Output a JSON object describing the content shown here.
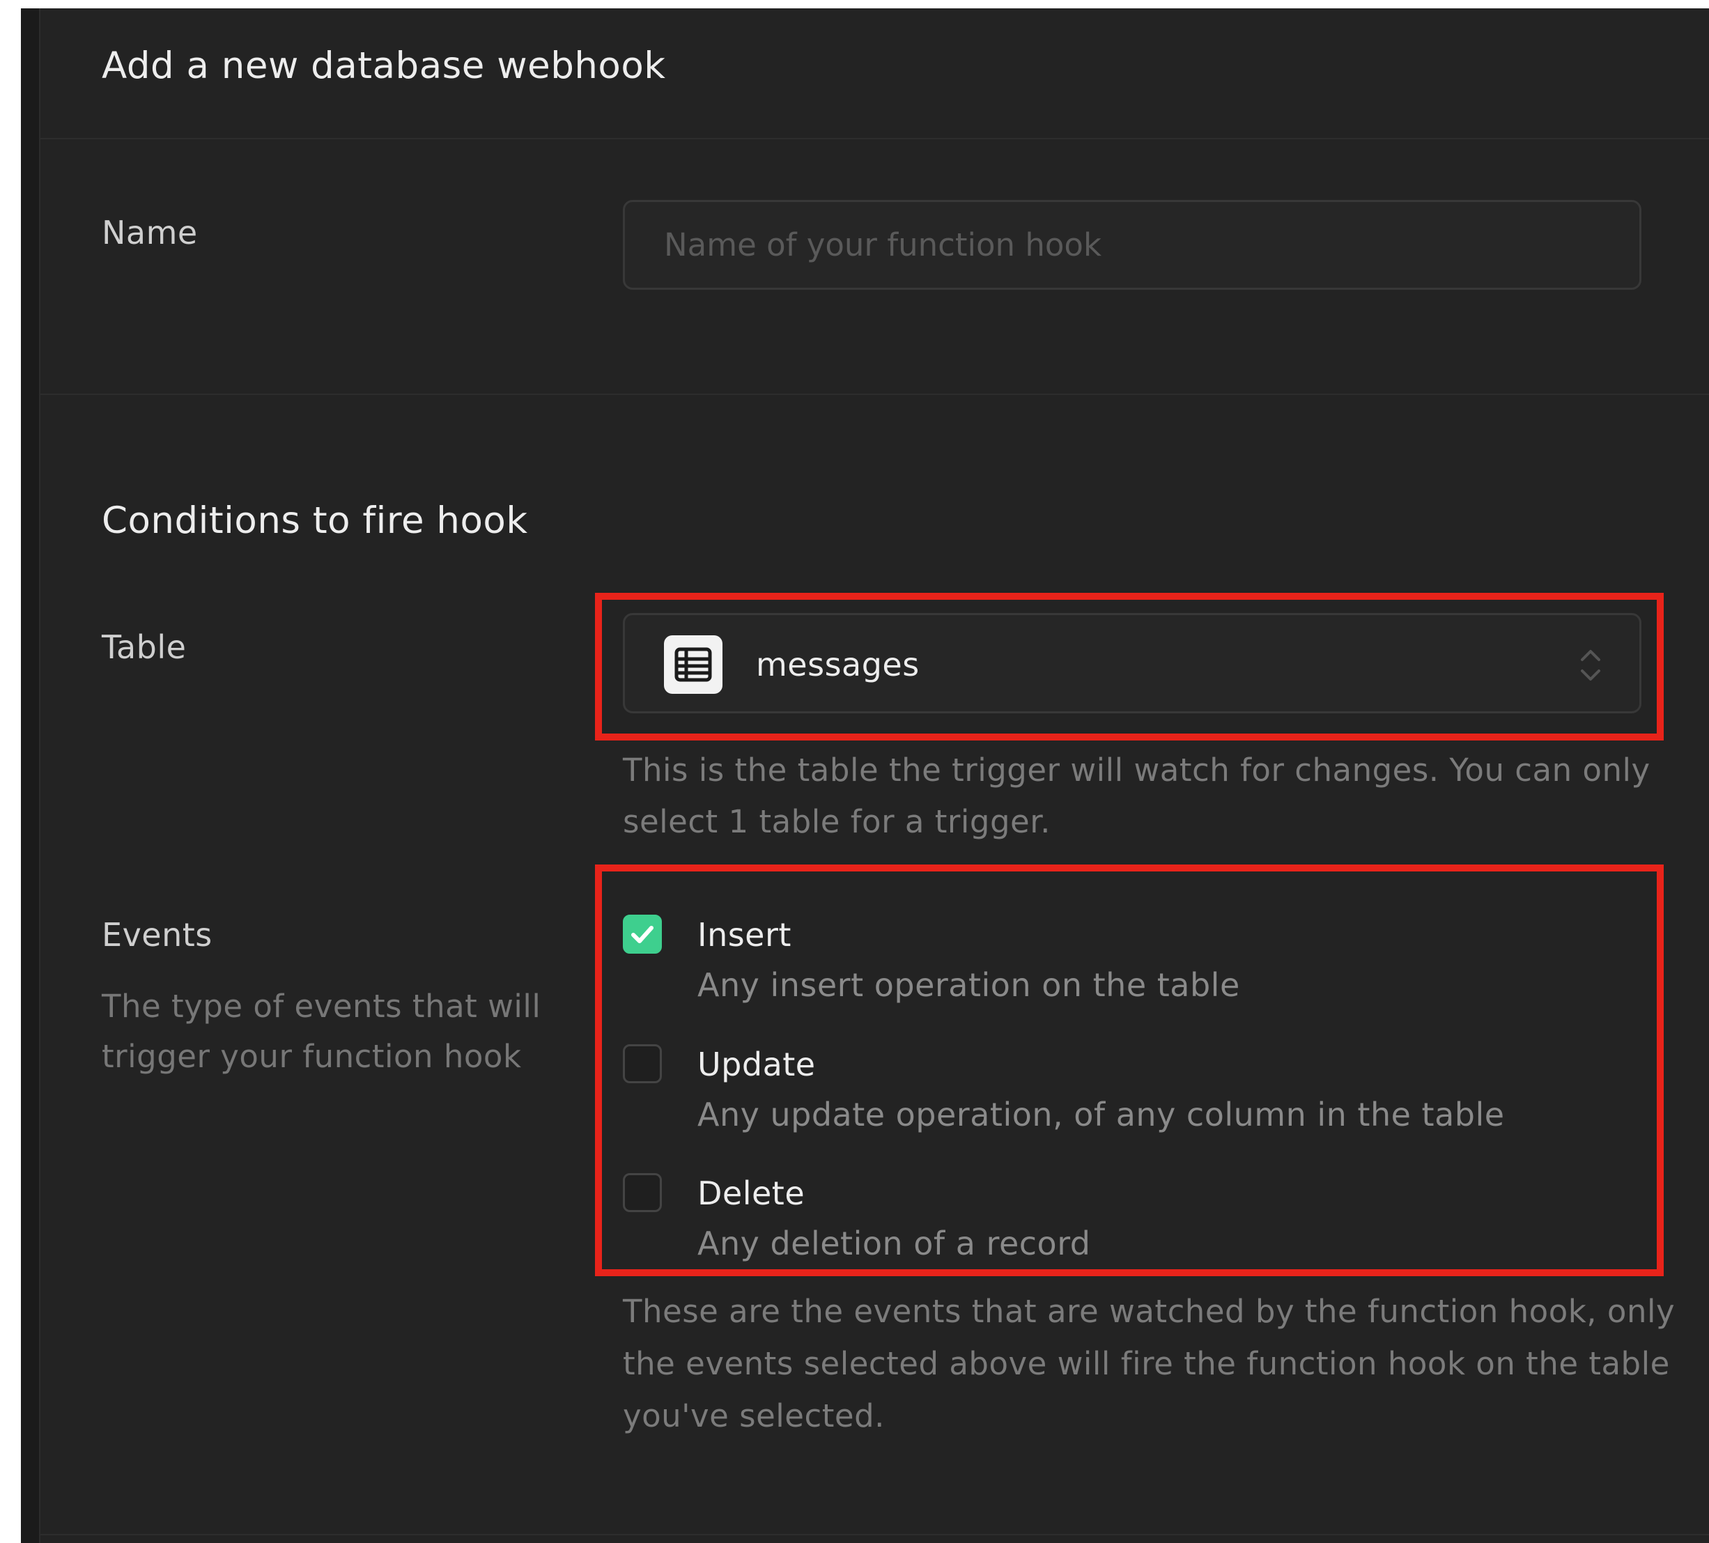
{
  "dialog": {
    "title": "Add a new database webhook"
  },
  "name_field": {
    "label": "Name",
    "placeholder": "Name of your function hook",
    "value": ""
  },
  "conditions": {
    "title": "Conditions to fire hook",
    "table": {
      "label": "Table",
      "selected": "messages",
      "icon": "table-icon",
      "help_line1": "This is the table the trigger will watch for changes. You can only",
      "help_line2": "select 1 table for a trigger."
    },
    "events": {
      "label": "Events",
      "desc_line1": "The type of events that will",
      "desc_line2": "trigger your function hook",
      "options": [
        {
          "label": "Insert",
          "description": "Any insert operation on the table",
          "checked": true
        },
        {
          "label": "Update",
          "description": "Any update operation, of any column in the table",
          "checked": false
        },
        {
          "label": "Delete",
          "description": "Any deletion of a record",
          "checked": false
        }
      ],
      "help_line1": "These are the events that are watched by the function hook, only",
      "help_line2": "the events selected above will fire the function hook on the table",
      "help_line3": "you've selected."
    }
  },
  "colors": {
    "accent": "#3ecf8e",
    "highlight": "#e8231a",
    "background": "#232323"
  }
}
